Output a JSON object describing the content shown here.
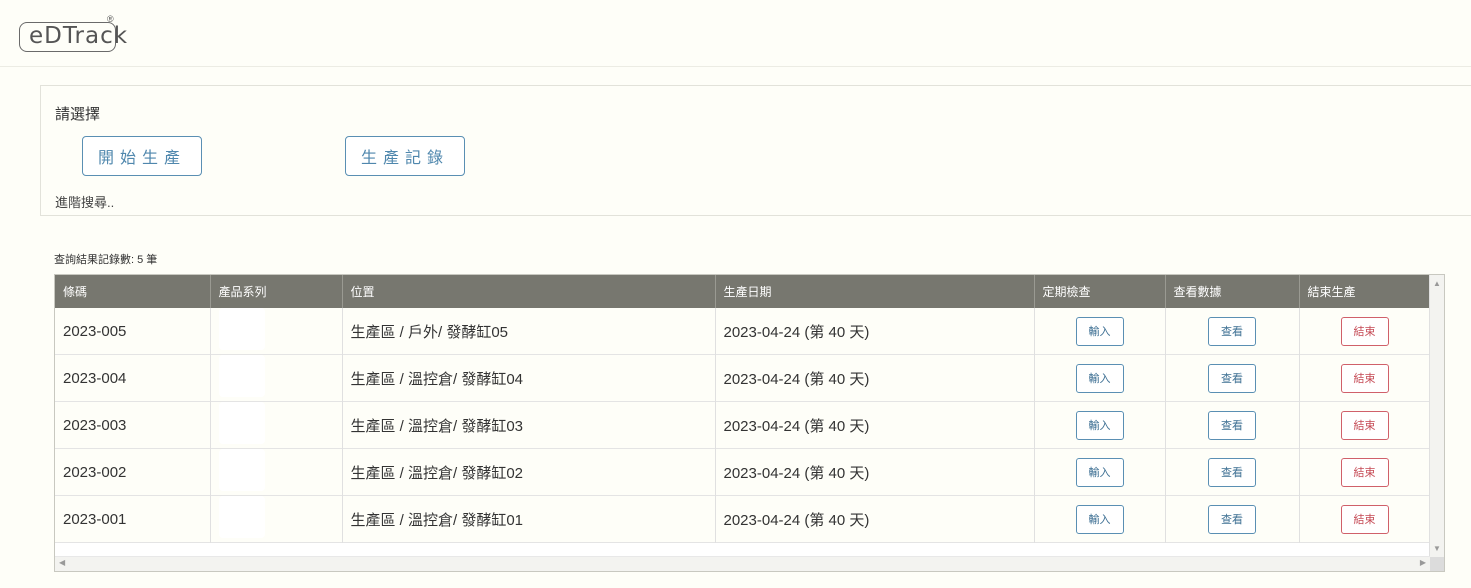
{
  "header": {
    "logo_text": "eDTrack",
    "logo_reg": "®"
  },
  "panel": {
    "title": "請選擇",
    "start_button": "開始生產",
    "records_button": "生產記錄",
    "advanced_search": "進階搜尋.."
  },
  "result_count": "查詢結果記錄數: 5 筆",
  "table": {
    "columns": [
      "條碼",
      "產品系列",
      "位置",
      "生產日期",
      "定期檢查",
      "查看數據",
      "結束生產"
    ],
    "rows": [
      {
        "barcode": "2023-005",
        "series": "",
        "location": "生產區 / 戶外/ 發酵缸05",
        "date": "2023-04-24 (第 40 天)",
        "check": "輸入",
        "view": "查看",
        "end": "結束"
      },
      {
        "barcode": "2023-004",
        "series": "",
        "location": "生產區 / 溫控倉/ 發酵缸04",
        "date": "2023-04-24 (第 40 天)",
        "check": "輸入",
        "view": "查看",
        "end": "結束"
      },
      {
        "barcode": "2023-003",
        "series": "",
        "location": "生產區 / 溫控倉/ 發酵缸03",
        "date": "2023-04-24 (第 40 天)",
        "check": "輸入",
        "view": "查看",
        "end": "結束"
      },
      {
        "barcode": "2023-002",
        "series": "",
        "location": "生產區 / 溫控倉/ 發酵缸02",
        "date": "2023-04-24 (第 40 天)",
        "check": "輸入",
        "view": "查看",
        "end": "結束"
      },
      {
        "barcode": "2023-001",
        "series": "",
        "location": "生產區 / 溫控倉/ 發酵缸01",
        "date": "2023-04-24 (第 40 天)",
        "check": "輸入",
        "view": "查看",
        "end": "結束"
      }
    ]
  },
  "colors": {
    "header_bg": "#77776f",
    "accent_blue": "#5a8fb3",
    "end_red": "#d0606a",
    "page_bg": "#fefef8"
  }
}
